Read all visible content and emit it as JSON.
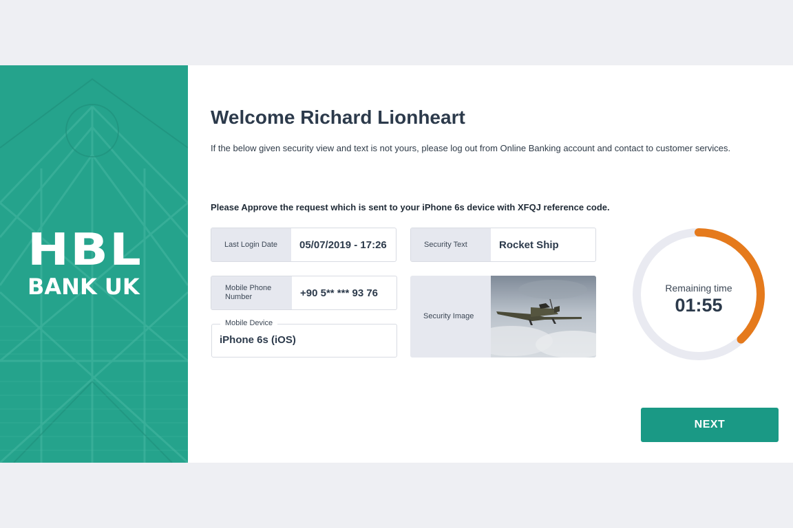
{
  "brand": {
    "logo_top": "HBL",
    "logo_bottom": "BANK UK",
    "color": "#25a38c"
  },
  "main": {
    "title": "Welcome Richard Lionheart",
    "subtitle": "If the below given security view and text is not yours, please log out from Online Banking account and contact to customer services.",
    "approve_text": "Please Approve the request which is sent to your iPhone 6s device with XFQJ reference code."
  },
  "fields": {
    "last_login": {
      "label": "Last Login Date",
      "value": "05/07/2019 - 17:26"
    },
    "mobile_phone": {
      "label": "Mobile Phone Number",
      "value": "+90 5** *** 93 76"
    },
    "mobile_device": {
      "label": "Mobile Device",
      "value": "iPhone 6s (iOS)"
    },
    "security_text": {
      "label": "Security Text",
      "value": "Rocket Ship"
    },
    "security_image": {
      "label": "Security Image",
      "image": "vintage propeller airplane in cloudy sky"
    }
  },
  "timer": {
    "label": "Remaining time",
    "value": "01:55",
    "progress_fraction": 0.38,
    "track_color": "#e9eaf1",
    "progress_color": "#e57a1c"
  },
  "actions": {
    "next_label": "NEXT",
    "next_color": "#1a9985"
  }
}
